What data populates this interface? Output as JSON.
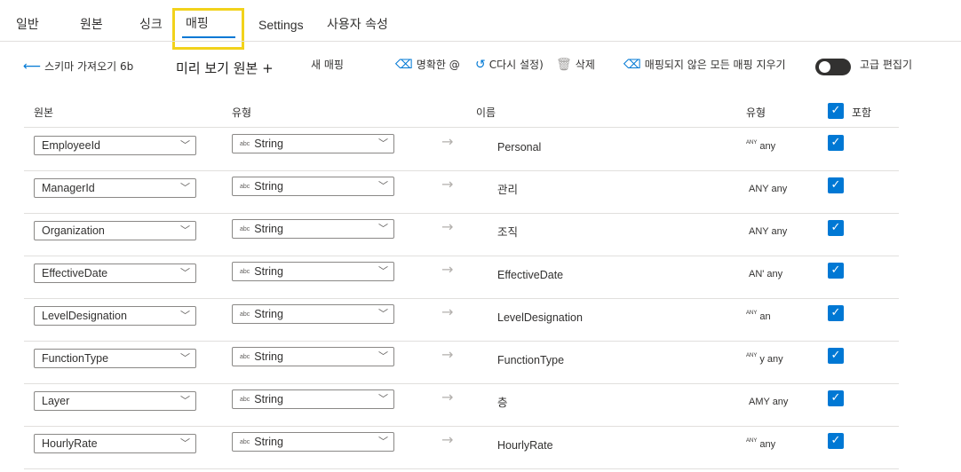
{
  "tabs": [
    {
      "label": "일반"
    },
    {
      "label": "원본"
    },
    {
      "label": "싱크"
    },
    {
      "label": "매핑",
      "active": true
    },
    {
      "label": "Settings"
    },
    {
      "label": "사용자 속성"
    }
  ],
  "toolbar": {
    "import_schema": "스키마 가져오기 6b",
    "preview_source": "미리 보기 원본 +",
    "new_mapping": "새 매핑",
    "clear": "명확한 @",
    "reset": "C다시 설정)",
    "delete": "삭제",
    "clear_unmapped": "매핑되지 않은 모든 매핑 지우기",
    "advanced_editor": "고급 편집기",
    "advanced_editor_on": false
  },
  "header": {
    "source": "원본",
    "source_type": "유형",
    "name": "이름",
    "dest_type": "유형",
    "include": "포함"
  },
  "rows": [
    {
      "source": "EmployeeId",
      "type_badge": "abc",
      "type": "String",
      "dest": "Personal",
      "dtype_badge": "ANY",
      "dtype": "any"
    },
    {
      "source": "ManagerId",
      "type_badge": "abc",
      "type": "String",
      "dest": "관리",
      "dtype_badge": "",
      "dtype": "ANY any"
    },
    {
      "source": "Organization",
      "type_badge": "abc",
      "type": "String",
      "dest": "조직",
      "dtype_badge": "",
      "dtype": "ANY any"
    },
    {
      "source": "EffectiveDate",
      "type_badge": "abc",
      "type": "String",
      "dest": "EffectiveDate",
      "dtype_badge": "",
      "dtype": "AN' any"
    },
    {
      "source": "LevelDesignation",
      "type_badge": "abc",
      "type": "String",
      "dest": "LevelDesignation",
      "dtype_badge": "ANY",
      "dtype": "an"
    },
    {
      "source": "FunctionType",
      "type_badge": "abc",
      "type": "String",
      "dest": "FunctionType",
      "dtype_badge": "ANY",
      "dtype": "y any"
    },
    {
      "source": "Layer",
      "type_badge": "abc",
      "type": "String",
      "dest": "층",
      "dtype_badge": "",
      "dtype": "AMY any"
    },
    {
      "source": "HourlyRate",
      "type_badge": "abc",
      "type": "String",
      "dest": "HourlyRate",
      "dtype_badge": "ANY",
      "dtype": "any"
    }
  ],
  "colors": {
    "accent": "#0078d4",
    "highlight": "#f2d21b"
  }
}
